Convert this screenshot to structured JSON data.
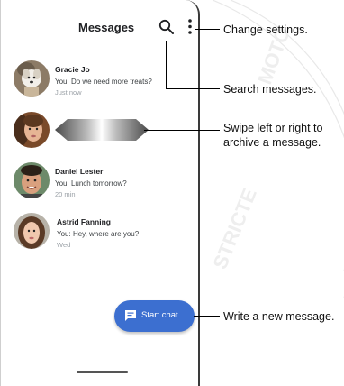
{
  "app": {
    "title": "Messages"
  },
  "conversations": [
    {
      "name": "Gracie Jo",
      "snippet": "You: Do we need more treats?",
      "time": "Just now"
    },
    {
      "name": "Daniel Lester",
      "snippet": "You: Lunch tomorrow?",
      "time": "20 min"
    },
    {
      "name": "Astrid Fanning",
      "snippet": "You: Hey, where are you?",
      "time": "Wed"
    }
  ],
  "fab": {
    "label": "Start chat",
    "icon": "chat-bubble-icon"
  },
  "callouts": {
    "settings": "Change settings.",
    "search": "Search messages.",
    "swipe_line1": "Swipe left or right to",
    "swipe_line2": "archive a message.",
    "new_message": "Write a new message."
  },
  "colors": {
    "fab": "#3c6fd0",
    "accent_text": "#202124"
  }
}
